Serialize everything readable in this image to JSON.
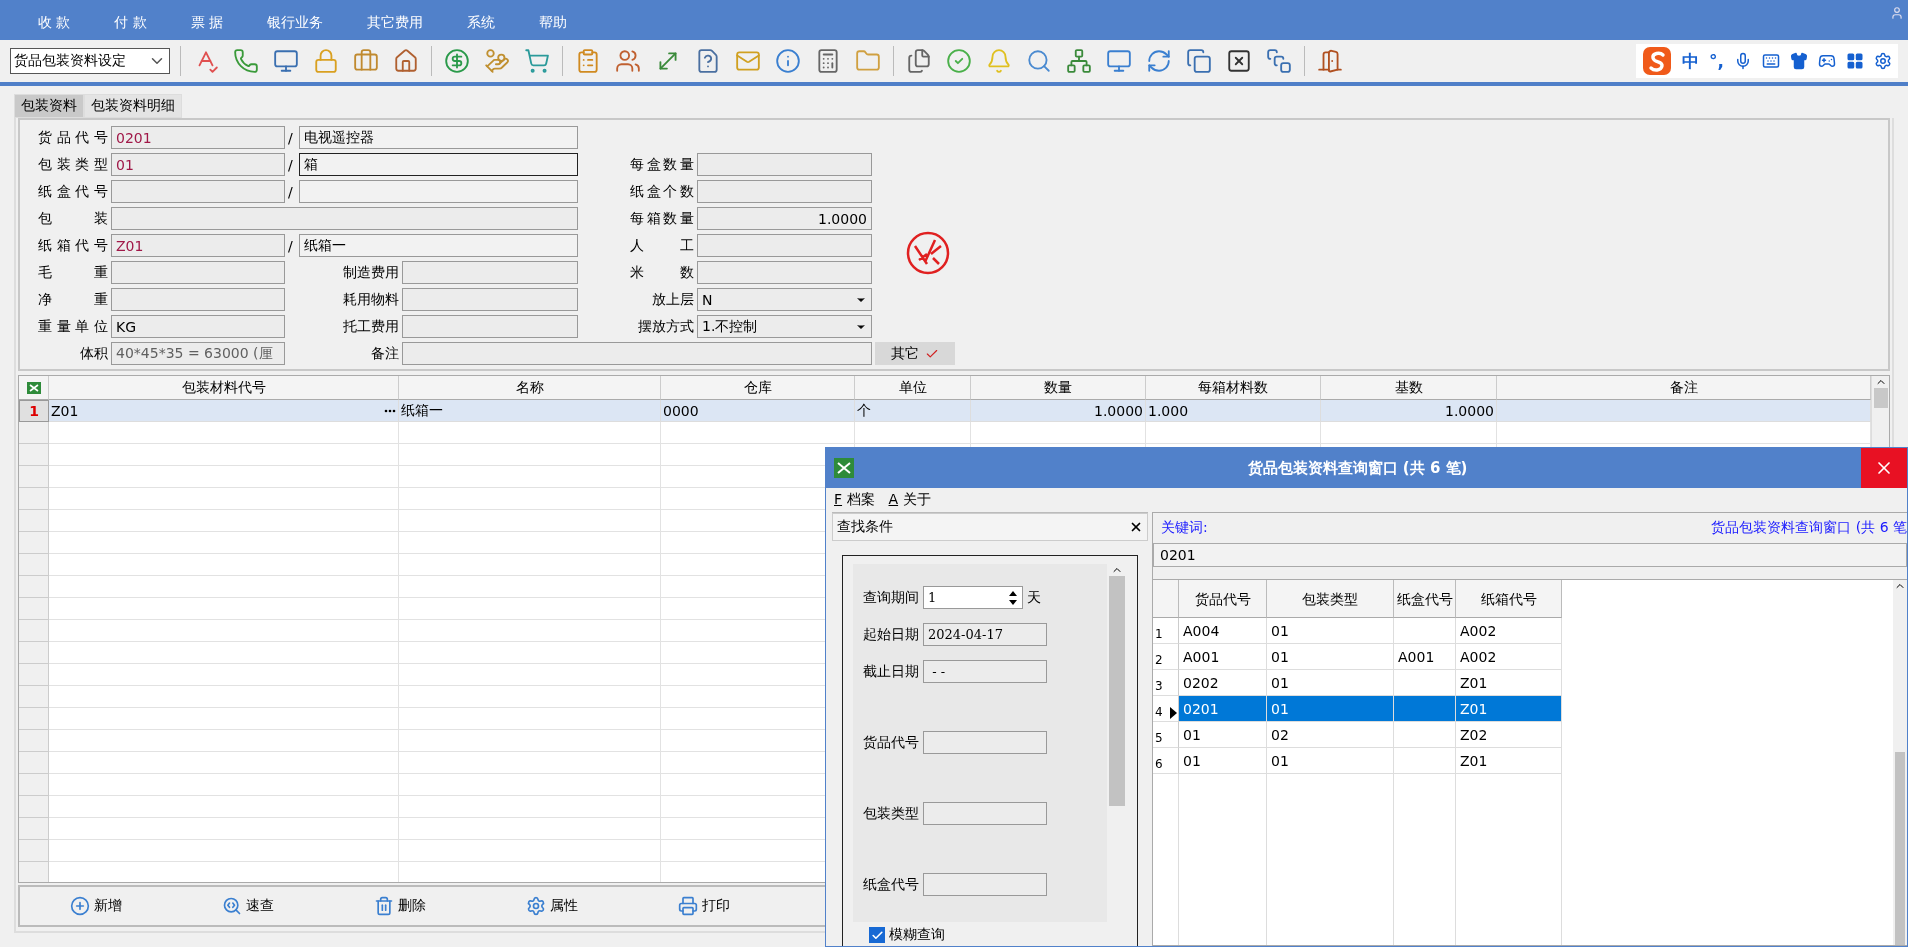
{
  "menu": [
    "收 款",
    "付 款",
    "票 据",
    "银行业务",
    "其它费用",
    "系统",
    "帮助"
  ],
  "toolbar": {
    "module": "货品包装资料设定"
  },
  "ime_bar": {
    "language": "中",
    "punctuation": "°,"
  },
  "tabs": [
    {
      "label": "包装资料",
      "selected": true
    },
    {
      "label": "包装资料明细",
      "selected": false
    }
  ],
  "form": {
    "rows": [
      {
        "label": "货品代号",
        "fields": [
          {
            "kind": "code",
            "value": "0201"
          },
          {
            "kind": "name",
            "separator": "/",
            "value": "电视遥控器",
            "focused": false
          }
        ]
      },
      {
        "label": "包装类型",
        "fields": [
          {
            "kind": "code",
            "value": "01"
          },
          {
            "kind": "name",
            "separator": "/",
            "value": "箱",
            "focused": true
          },
          {
            "kind": "right",
            "label": "每盒数量"
          }
        ]
      },
      {
        "label": "纸盒代号",
        "fields": [
          {
            "kind": "code"
          },
          {
            "kind": "name",
            "separator": "/",
            "focused": false
          },
          {
            "kind": "right",
            "label": "纸盒个数"
          }
        ]
      },
      {
        "label": "包 装",
        "fields": [
          {
            "kind": "wide"
          },
          {
            "kind": "right-number",
            "label": "每箱数量",
            "value": "1.0000"
          }
        ]
      },
      {
        "label": "纸箱代号",
        "fields": [
          {
            "kind": "code",
            "value": "Z01"
          },
          {
            "kind": "name",
            "separator": "/",
            "value": "纸箱一",
            "focused": false
          },
          {
            "kind": "right",
            "label": "人 工"
          }
        ]
      },
      {
        "label": "毛 重",
        "fields": [
          {
            "kind": "code"
          },
          {
            "kind": "mid",
            "label": "制造费用"
          },
          {
            "kind": "right",
            "label": "米 数"
          }
        ]
      },
      {
        "label": "净 重",
        "fields": [
          {
            "kind": "code"
          },
          {
            "kind": "mid",
            "label": "耗用物料"
          },
          {
            "kind": "right-select",
            "label": "放上层",
            "value": "N"
          }
        ]
      },
      {
        "label": "重量单位",
        "fields": [
          {
            "kind": "plain",
            "value": "KG"
          },
          {
            "kind": "mid",
            "label": "托工费用"
          },
          {
            "kind": "right-select",
            "label": "摆放方式",
            "value": "1.不控制"
          }
        ]
      },
      {
        "label": "体积",
        "fields": [
          {
            "kind": "readonly",
            "value": "40*45*35 = 63000 (厘"
          },
          {
            "kind": "note",
            "label": "备注"
          },
          {
            "kind": "button",
            "label": "其它"
          }
        ]
      }
    ]
  },
  "grid": {
    "columns": [
      "包装材料代号",
      "名称",
      "仓库",
      "单位",
      "数量",
      "每箱材料数",
      "基数",
      "备注"
    ],
    "rows": [
      {
        "number": "1",
        "selected": true,
        "cells": [
          "Z01",
          "纸箱一",
          "0000",
          "个",
          "1.0000",
          "1.000",
          "1.0000",
          null
        ]
      }
    ]
  },
  "actions": [
    "新增",
    "速查",
    "删除",
    "属性",
    "打印"
  ],
  "popup": {
    "title": "货品包装资料查询窗口 (共 6 笔)",
    "menu": [
      {
        "key": "F",
        "label": "档案"
      },
      {
        "key": "A",
        "label": "关于"
      }
    ],
    "search_panel": {
      "title": "查找条件",
      "fields": [
        {
          "kind": "spin",
          "label": "查询期间",
          "value": "1",
          "unit": "天"
        },
        {
          "kind": "date",
          "label": "起始日期",
          "value": "2024-04-17"
        },
        {
          "kind": "date",
          "label": "截止日期",
          "value": " - -"
        },
        {
          "kind": "text",
          "label": "货品代号"
        },
        {
          "kind": "text",
          "label": "包装类型"
        },
        {
          "kind": "text",
          "label": "纸盒代号"
        }
      ],
      "fuzzy": {
        "label": "模糊查询",
        "checked": true
      }
    },
    "keyword": {
      "label": "关键词:",
      "caption": "货品包装资料查询窗口 (共 6 笔",
      "value": "0201"
    },
    "grid": {
      "columns": [
        "货品代号",
        "包装类型",
        "纸盒代号",
        "纸箱代号"
      ],
      "rows": [
        {
          "number": "1",
          "selected": false,
          "cells": [
            "A004",
            "01",
            null,
            "A002"
          ]
        },
        {
          "number": "2",
          "selected": false,
          "cells": [
            "A001",
            "01",
            "A001",
            "A002"
          ]
        },
        {
          "number": "3",
          "selected": false,
          "cells": [
            "0202",
            "01",
            null,
            "Z01"
          ]
        },
        {
          "number": "4",
          "selected": true,
          "cells": [
            "0201",
            "01",
            null,
            "Z01"
          ]
        },
        {
          "number": "5",
          "selected": false,
          "cells": [
            "01",
            "02",
            null,
            "Z02"
          ]
        },
        {
          "number": "6",
          "selected": false,
          "cells": [
            "01",
            "01",
            null,
            "Z01"
          ]
        }
      ]
    }
  }
}
